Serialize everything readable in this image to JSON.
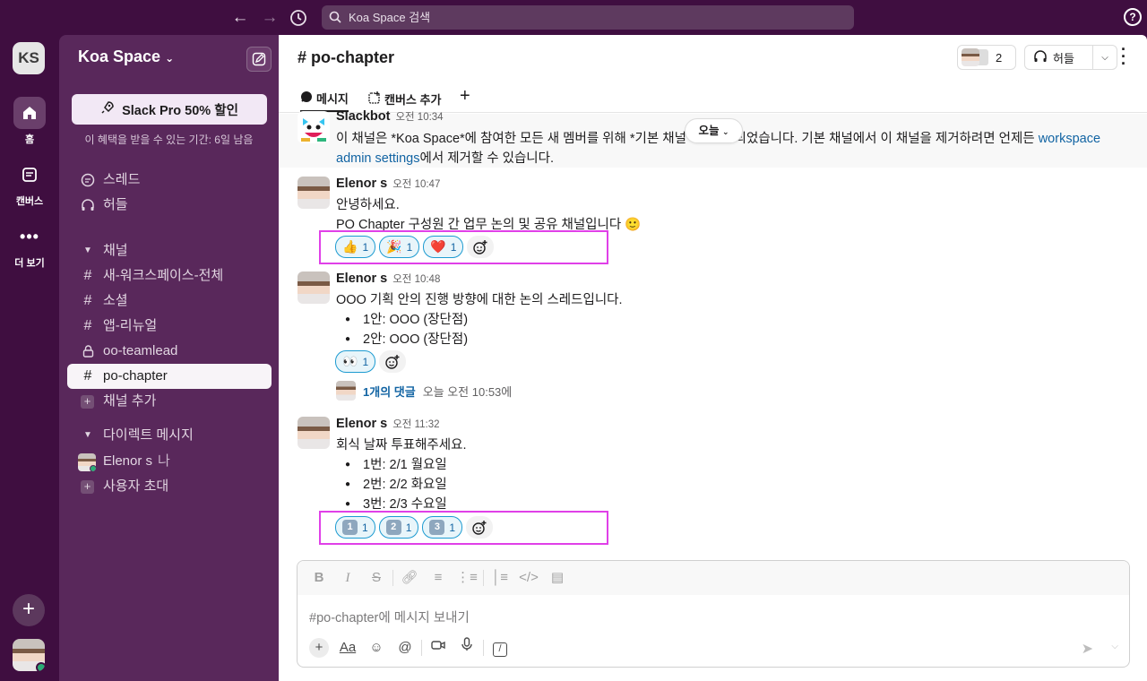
{
  "topbar": {
    "back_icon": "arrow-left-icon",
    "forward_icon": "arrow-right-icon",
    "history_icon": "clock-icon",
    "search_placeholder": "Koa Space 검색",
    "help_label": "?"
  },
  "rail": {
    "workspace_initials": "KS",
    "home_label": "홈",
    "canvas_label": "캔버스",
    "more_label": "더 보기",
    "add_label": "+"
  },
  "sidebar": {
    "workspace_name": "Koa Space",
    "promo_label": "Slack Pro 50% 할인",
    "promo_sub": "이 혜택을 받을 수 있는 기간: 6일 남음",
    "threads_label": "스레드",
    "huddles_label": "허들",
    "channels_header": "채널",
    "channels": [
      {
        "name": "새-워크스페이스-전체",
        "icon": "#"
      },
      {
        "name": "소셜",
        "icon": "#"
      },
      {
        "name": "앱-리뉴얼",
        "icon": "#"
      },
      {
        "name": "oo-teamlead",
        "icon": "lock"
      },
      {
        "name": "po-chapter",
        "icon": "#"
      }
    ],
    "add_channel_label": "채널 추가",
    "dm_header": "다이렉트 메시지",
    "dm_user": "Elenor s",
    "dm_me_tag": "나",
    "invite_label": "사용자 초대"
  },
  "channel": {
    "title": "# po-chapter",
    "member_count": "2",
    "huddle_label": "허들",
    "tab_messages": "메시지",
    "tab_canvas": "캔버스 추가",
    "date_pill": "오늘"
  },
  "messages": {
    "m1": {
      "author": "Slackbot",
      "time": "오전 10:34",
      "line1": "이 채널은 *Koa Space*에 참여한 모든 새 멤버를 위해 *기본 채널* 로 설정되었습니다. 기본 채널에서 이 채널을 제거하려면 언제든 ",
      "link1": "workspace",
      "link2": "admin settings",
      "line2_tail": "에서 제거할 수 있습니다."
    },
    "m2": {
      "author": "Elenor s",
      "time": "오전 10:47",
      "line1": "안녕하세요.",
      "line2": "PO Chapter 구성원 간 업무 논의 및 공유 채널입니다 🙂",
      "reactions": [
        {
          "emoji": "👍",
          "count": "1"
        },
        {
          "emoji": "🎉",
          "count": "1"
        },
        {
          "emoji": "❤️",
          "count": "1"
        }
      ]
    },
    "m3": {
      "author": "Elenor s",
      "time": "오전 10:48",
      "line1": "OOO 기획 안의 진행 방향에 대한 논의 스레드입니다.",
      "bullets": [
        "1안: OOO (장단점)",
        "2안: OOO (장단점)"
      ],
      "reaction": {
        "emoji": "👀",
        "count": "1"
      },
      "thread_count": "1개의 댓글",
      "thread_time": "오늘 오전 10:53에"
    },
    "m4": {
      "author": "Elenor s",
      "time": "오전 11:32",
      "line1": "회식 날짜 투표해주세요.",
      "bullets": [
        "1번: 2/1 월요일",
        "2번: 2/2 화요일",
        "3번: 2/3 수요일"
      ],
      "reactions": [
        {
          "emoji": "1",
          "count": "1"
        },
        {
          "emoji": "2",
          "count": "1"
        },
        {
          "emoji": "3",
          "count": "1"
        }
      ]
    }
  },
  "composer": {
    "placeholder": "#po-chapter에 메시지 보내기",
    "format_buttons": [
      "B",
      "I",
      "S"
    ]
  },
  "colors": {
    "aubergine": "#3f0e40",
    "sidebar": "#59285b",
    "highlight": "#e040e8",
    "link": "#1264a3"
  }
}
